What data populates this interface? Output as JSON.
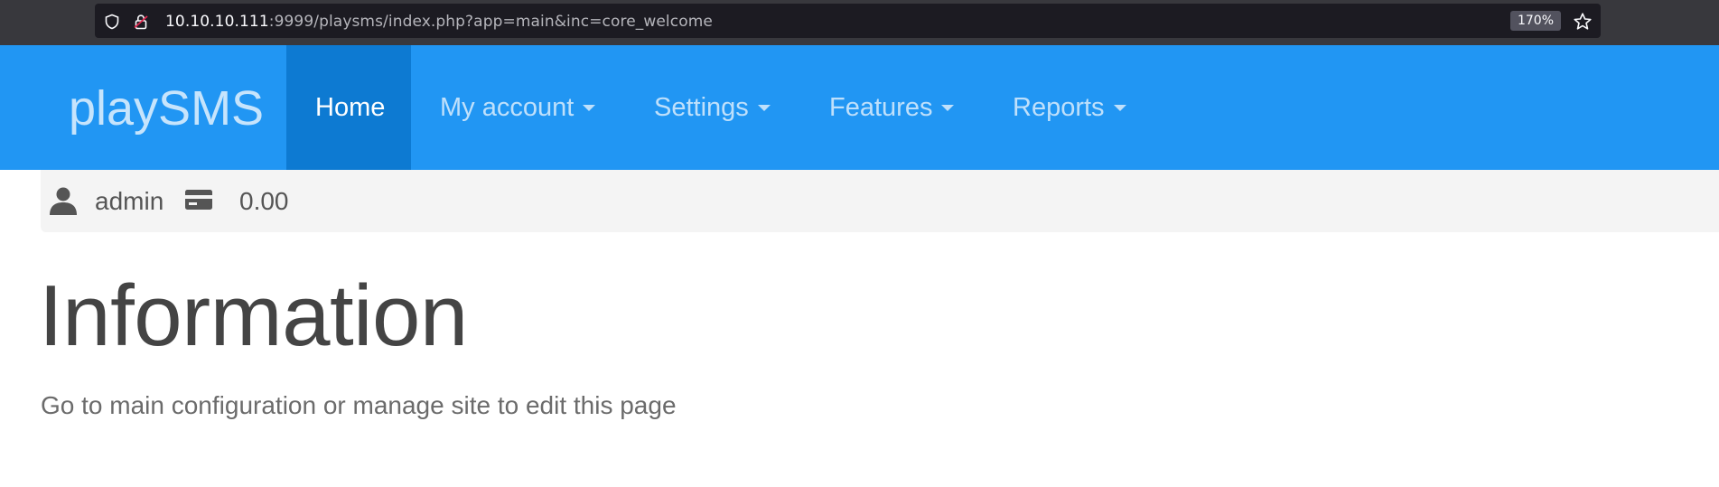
{
  "browser": {
    "url_host": "10.10.10.111",
    "url_rest": ":9999/playsms/index.php?app=main&inc=core_welcome",
    "zoom": "170%"
  },
  "navbar": {
    "brand": "playSMS",
    "items": [
      {
        "label": "Home",
        "active": true
      },
      {
        "label": "My account",
        "dropdown": true
      },
      {
        "label": "Settings",
        "dropdown": true
      },
      {
        "label": "Features",
        "dropdown": true
      },
      {
        "label": "Reports",
        "dropdown": true
      }
    ],
    "colors": {
      "background": "#2196f3",
      "active": "#0d7ad2"
    }
  },
  "userbar": {
    "username": "admin",
    "credit": "0.00",
    "icons": [
      "user-icon",
      "credit-card-icon"
    ]
  },
  "main": {
    "title": "Information",
    "description": "Go to main configuration or manage site to edit this page"
  }
}
